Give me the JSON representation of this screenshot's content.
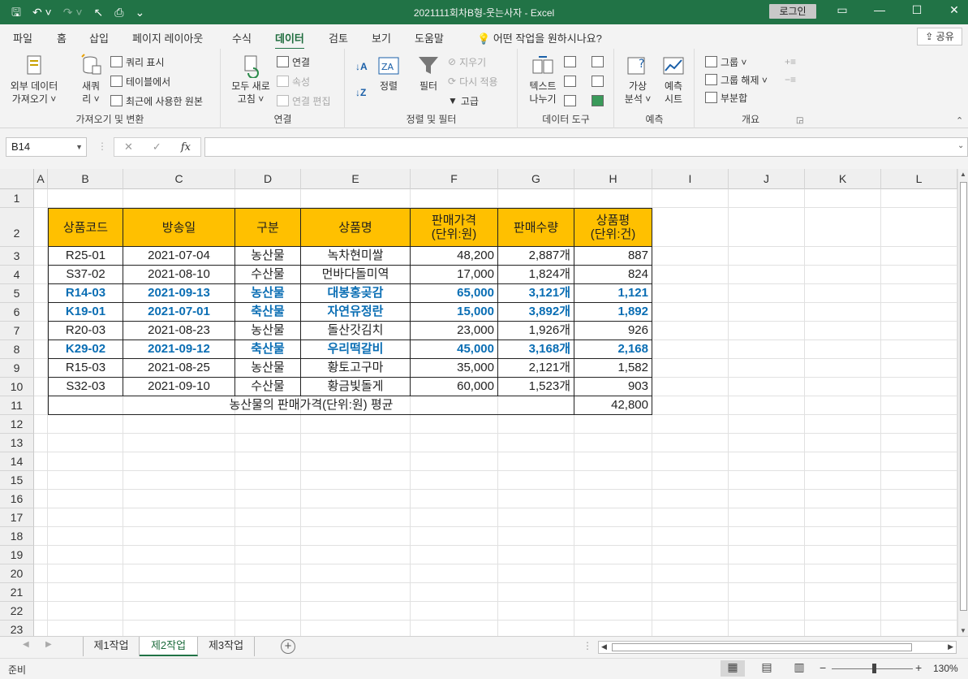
{
  "titlebar": {
    "title": "2021111회차B형-웃는사자  -  Excel",
    "login": "로그인",
    "save_glyph": "🖫",
    "undo_glyph": "↶ ˅",
    "redo_glyph": "↷ ˅",
    "touch_glyph": "↖",
    "preview_glyph": "⎙",
    "customize_glyph": "⌄",
    "ribbon_display_glyph": "▭",
    "minimize_glyph": "—",
    "maximize_glyph": "☐",
    "close_glyph": "✕"
  },
  "tabs": [
    "파일",
    "홈",
    "삽입",
    "페이지 레이아웃",
    "수식",
    "데이터",
    "검토",
    "보기",
    "도움말"
  ],
  "active_tab": "데이터",
  "tell_me": "어떤 작업을 원하시나요?",
  "share": "공유",
  "ribbon": {
    "groups": {
      "get_transform": "가져오기 및 변환",
      "connections": "연결",
      "sort_filter": "정렬 및 필터",
      "data_tools": "데이터 도구",
      "forecast": "예측",
      "outline": "개요"
    },
    "external_data": [
      "외부 데이터",
      "가져오기 ˅"
    ],
    "new_query": [
      "새쿼",
      "리 ˅"
    ],
    "show_query": "쿼리 표시",
    "from_table": "테이블에서",
    "recent_sources": "최근에 사용한 원본",
    "refresh_all": [
      "모두 새로",
      "고침 ˅"
    ],
    "connections": "연결",
    "properties": "속성",
    "edit_links": "연결 편집",
    "sort": "정렬",
    "filter": "필터",
    "clear": "지우기",
    "reapply": "다시 적용",
    "advanced": "고급",
    "text_to_columns": [
      "텍스트",
      "나누기"
    ],
    "what_if": [
      "가상",
      "분석 ˅"
    ],
    "forecast_sheet": [
      "예측",
      "시트"
    ],
    "group": "그룹  ˅",
    "ungroup": "그룹 해제  ˅",
    "subtotal": "부분합"
  },
  "formula_bar": {
    "name_box": "B14",
    "formula": "",
    "cancel_glyph": "✕",
    "enter_glyph": "✓",
    "fx_glyph": "fx"
  },
  "columns": [
    "A",
    "B",
    "C",
    "D",
    "E",
    "F",
    "G",
    "H",
    "I",
    "J",
    "K",
    "L"
  ],
  "rows": [
    "1",
    "2",
    "3",
    "4",
    "5",
    "6",
    "7",
    "8",
    "9",
    "10",
    "11",
    "12",
    "13",
    "14",
    "15",
    "16",
    "17",
    "18",
    "19",
    "20",
    "21",
    "22",
    "23"
  ],
  "table": {
    "headers": [
      "상품코드",
      "방송일",
      "구분",
      "상품명",
      "판매가격\n(단위:원)",
      "판매수량",
      "상품평\n(단위:건)"
    ],
    "rows": [
      {
        "code": "R25-01",
        "date": "2021-07-04",
        "category": "농산물",
        "name": "녹차현미쌀",
        "price": "48,200",
        "qty": "2,887개",
        "reviews": "887",
        "highlight": false
      },
      {
        "code": "S37-02",
        "date": "2021-08-10",
        "category": "수산물",
        "name": "먼바다돌미역",
        "price": "17,000",
        "qty": "1,824개",
        "reviews": "824",
        "highlight": false
      },
      {
        "code": "R14-03",
        "date": "2021-09-13",
        "category": "농산물",
        "name": "대봉홍곶감",
        "price": "65,000",
        "qty": "3,121개",
        "reviews": "1,121",
        "highlight": true
      },
      {
        "code": "K19-01",
        "date": "2021-07-01",
        "category": "축산물",
        "name": "자연유정란",
        "price": "15,000",
        "qty": "3,892개",
        "reviews": "1,892",
        "highlight": true
      },
      {
        "code": "R20-03",
        "date": "2021-08-23",
        "category": "농산물",
        "name": "돌산갓김치",
        "price": "23,000",
        "qty": "1,926개",
        "reviews": "926",
        "highlight": false
      },
      {
        "code": "K29-02",
        "date": "2021-09-12",
        "category": "축산물",
        "name": "우리떡갈비",
        "price": "45,000",
        "qty": "3,168개",
        "reviews": "2,168",
        "highlight": true
      },
      {
        "code": "R15-03",
        "date": "2021-08-25",
        "category": "농산물",
        "name": "황토고구마",
        "price": "35,000",
        "qty": "2,121개",
        "reviews": "1,582",
        "highlight": false
      },
      {
        "code": "S32-03",
        "date": "2021-09-10",
        "category": "수산물",
        "name": "황금빛돌게",
        "price": "60,000",
        "qty": "1,523개",
        "reviews": "903",
        "highlight": false
      }
    ],
    "summary_label": "농산물의 판매가격(단위:원) 평균",
    "summary_value": "42,800"
  },
  "sheets": [
    "제1작업",
    "제2작업",
    "제3작업"
  ],
  "active_sheet": "제2작업",
  "status": {
    "ready": "준비",
    "zoom": "130%",
    "zoom_minus": "−",
    "zoom_plus": "+"
  },
  "colors": {
    "brand": "#217346",
    "header_fill": "#ffc000",
    "highlight_text": "#0a6eb4"
  }
}
